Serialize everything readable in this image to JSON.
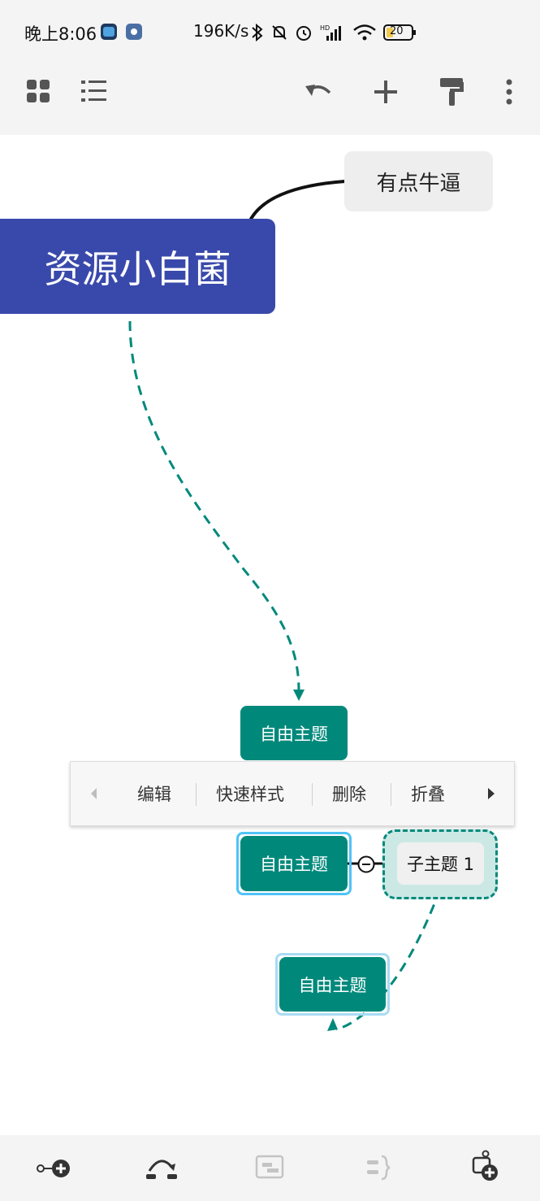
{
  "status_bar": {
    "time": "晚上8:06",
    "net_speed": "196K/s",
    "battery": "20"
  },
  "toolbar": {
    "icons": [
      "grid-icon",
      "outline-list-icon",
      "undo-icon",
      "add-icon",
      "format-painter-icon",
      "more-vert-icon"
    ]
  },
  "mindmap": {
    "central_topic": "资源小白菌",
    "sub_topic_top": "有点牛逼",
    "free_topic_1": "自由主题",
    "free_topic_2": "自由主题",
    "free_topic_3": "自由主题",
    "child_topic": "子主题 1"
  },
  "context_menu": {
    "items": [
      "编辑",
      "快速样式",
      "删除",
      "折叠"
    ]
  },
  "colors": {
    "central": "#3949ab",
    "free_topic": "#00897b",
    "selection": "#4fc3f7",
    "dashed_link": "#00897b",
    "boundary_fill": "#cce8e5"
  },
  "bottom_bar": {
    "icons": [
      "add-subtopic-icon",
      "relationship-icon",
      "summary-box-icon",
      "summary-brace-icon",
      "add-floating-topic-icon"
    ]
  }
}
